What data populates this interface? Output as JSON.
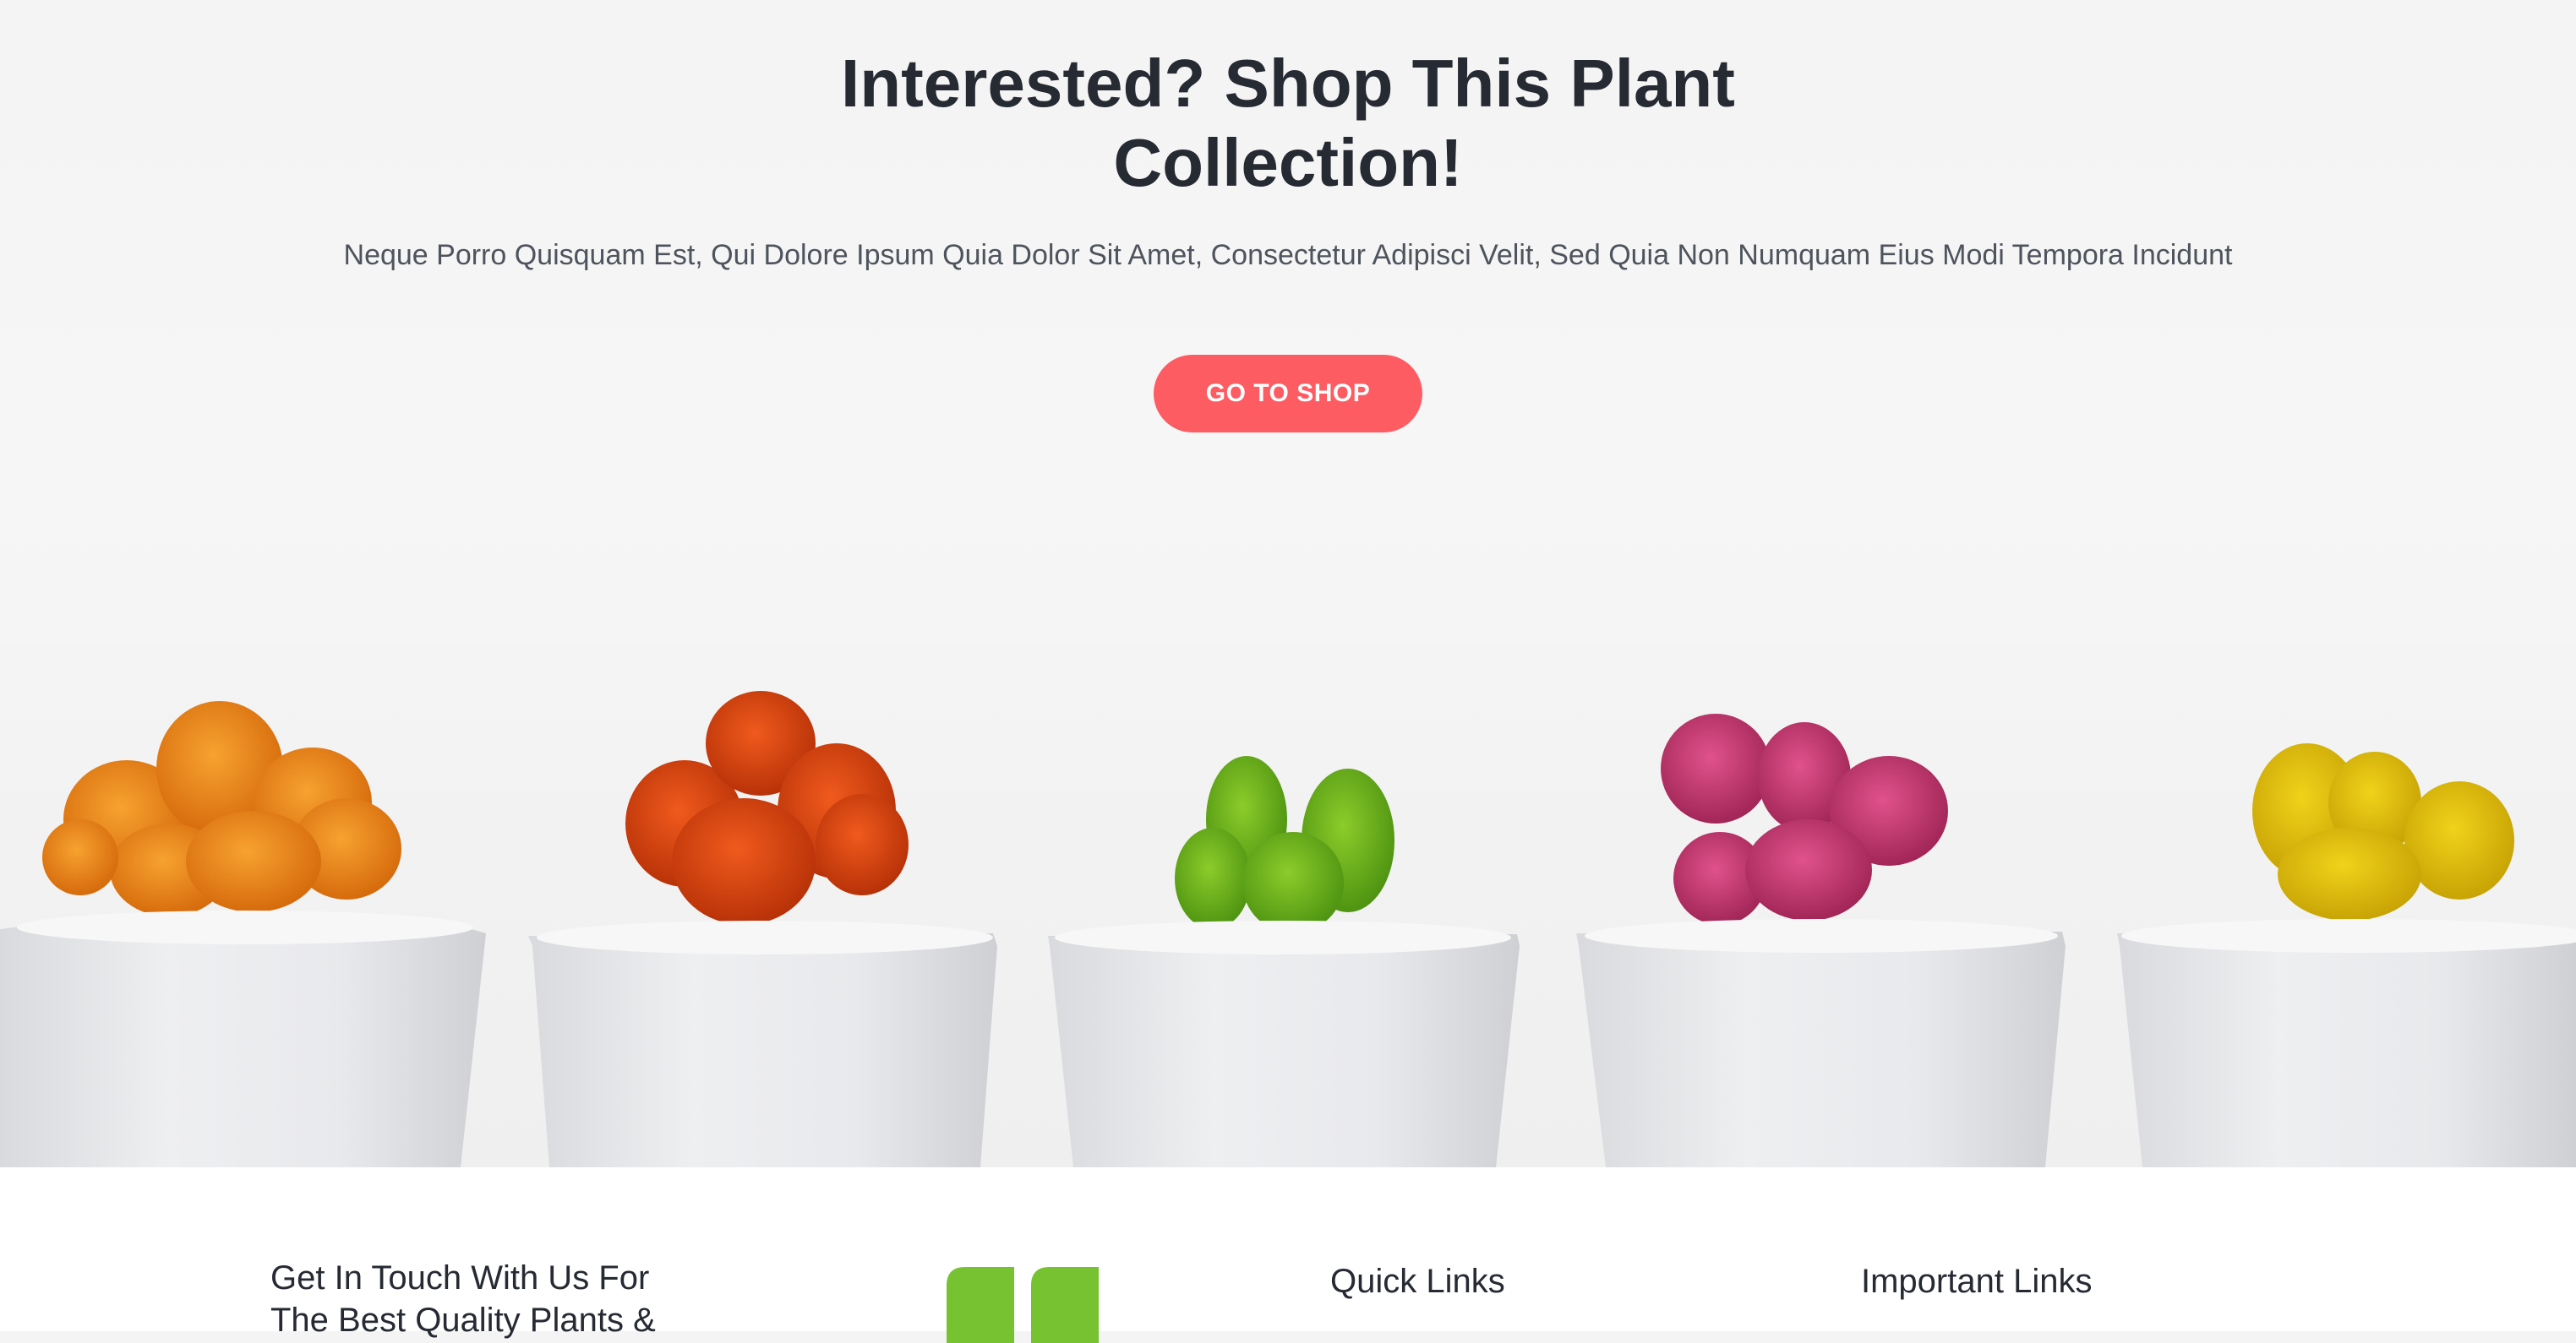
{
  "hero": {
    "title_line1": "Interested? Shop This Plant",
    "title_line2": "Collection!",
    "subtitle": "Neque Porro Quisquam Est, Qui Dolore Ipsum Quia Dolor Sit Amet, Consectetur Adipisci Velit, Sed Quia Non Numquam Eius Modi Tempora Incidunt",
    "cta_label": "GO TO SHOP"
  },
  "footer": {
    "touch_line1": "Get In Touch With Us For",
    "touch_line2": "The Best Quality Plants &",
    "quick_links_title": "Quick Links",
    "important_links_title": "Important Links"
  },
  "colors": {
    "accent": "#fd5c63",
    "heading": "#262a33",
    "brand_green": "#76c230"
  },
  "icons": {
    "logo": "leaf-logo-icon"
  }
}
